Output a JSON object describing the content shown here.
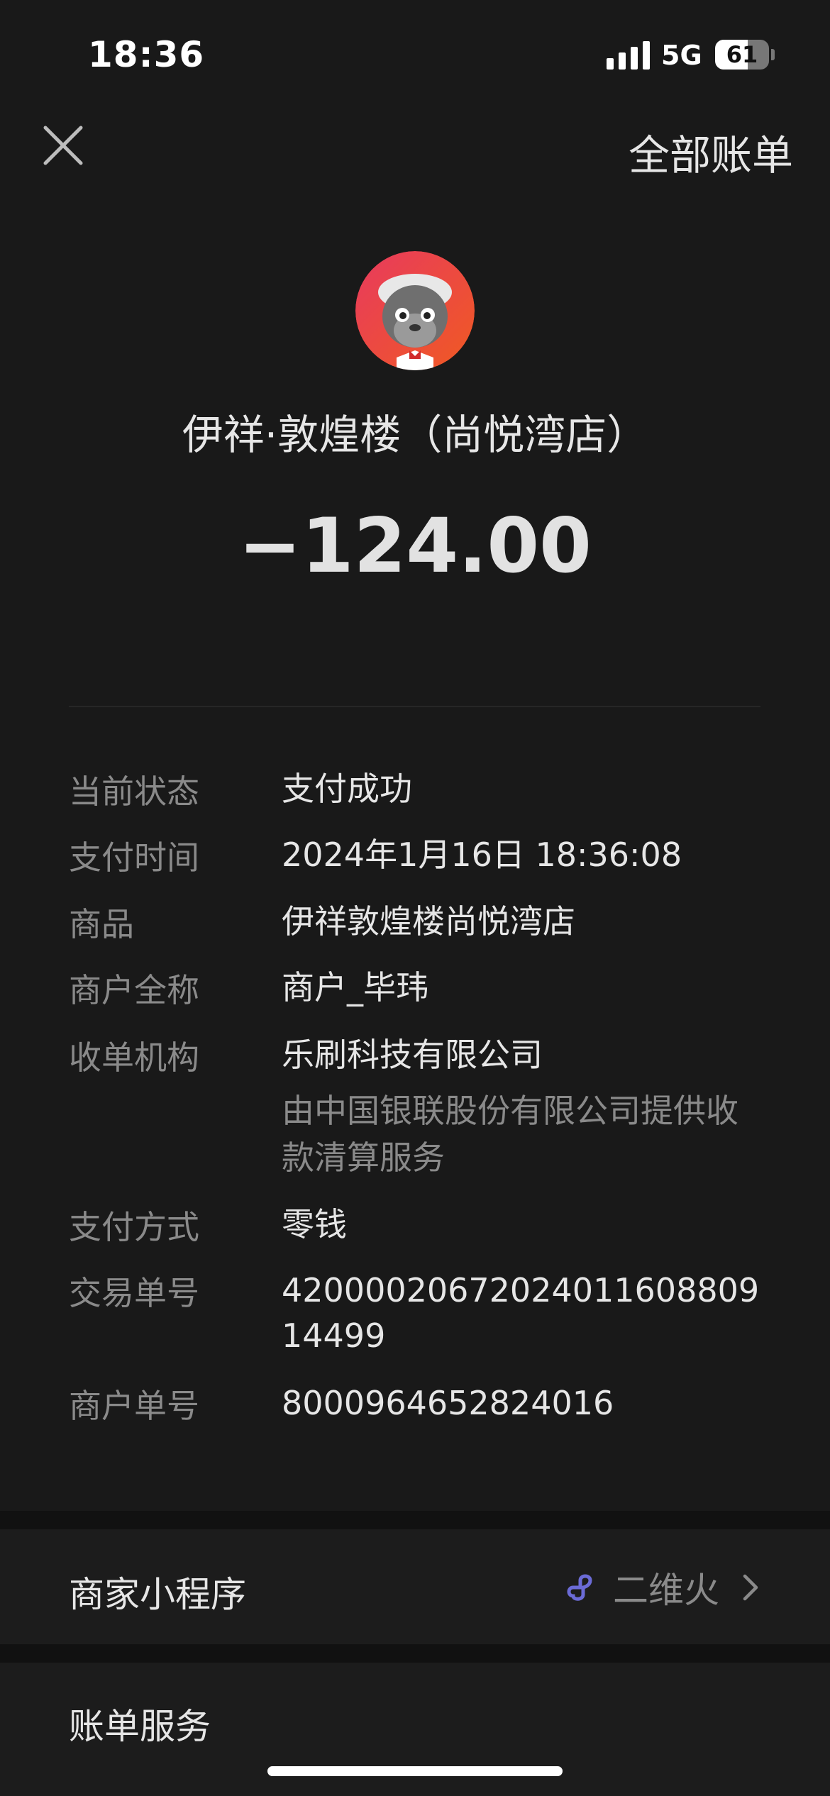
{
  "status_bar": {
    "time": "18:36",
    "network": "5G",
    "battery": "61",
    "battery_level": 0.61
  },
  "nav": {
    "all_bills": "全部账单"
  },
  "merchant": {
    "name": "伊祥·敦煌楼（尚悦湾店）",
    "amount": "−124.00"
  },
  "details": [
    {
      "label": "当前状态",
      "value": "支付成功"
    },
    {
      "label": "支付时间",
      "value": "2024年1月16日 18:36:08"
    },
    {
      "label": "商品",
      "value": "伊祥敦煌楼尚悦湾店"
    },
    {
      "label": "商户全称",
      "value": "商户_毕玮"
    },
    {
      "label": "收单机构",
      "value": "乐刷科技有限公司",
      "sub": "由中国银联股份有限公司提供收款清算服务"
    },
    {
      "label": "支付方式",
      "value": "零钱"
    },
    {
      "label": "交易单号",
      "value": "4200002067202401160880914499"
    },
    {
      "label": "商户单号",
      "value": "8000964652824016"
    }
  ],
  "mini_program": {
    "label": "商家小程序",
    "name": "二维火",
    "icon": "mini-program-icon"
  },
  "bill_service": {
    "label": "账单服务"
  },
  "colors": {
    "background": "#191919",
    "band": "#111111",
    "card": "#1c1c1c",
    "accent": "#6b6bd6",
    "muted": "#8a8a8a"
  }
}
